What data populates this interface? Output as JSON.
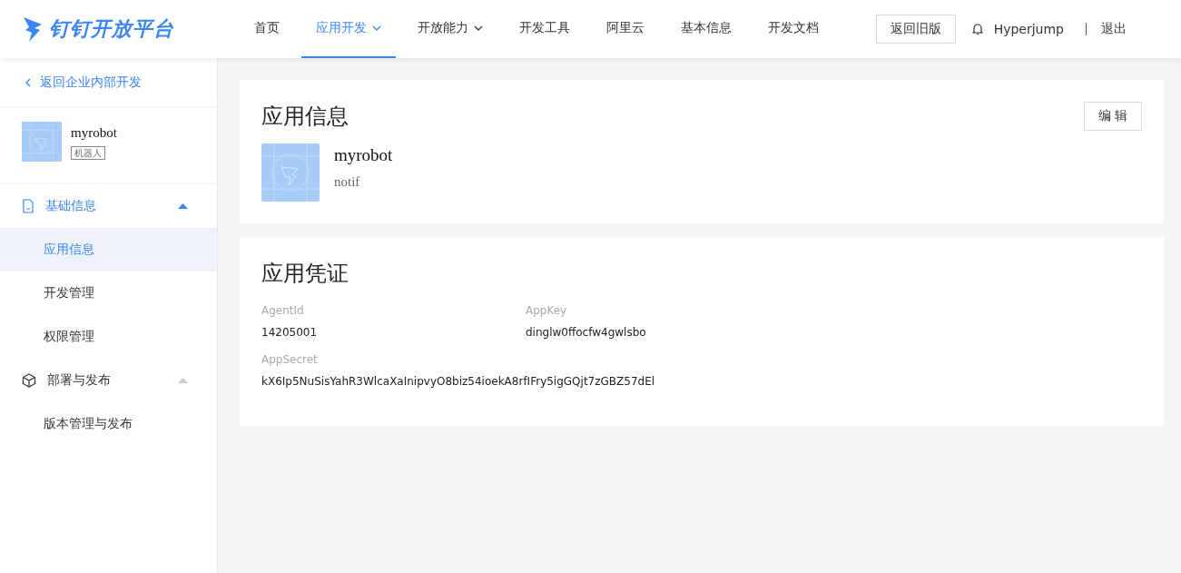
{
  "header": {
    "logo": "钉钉开放平台",
    "nav": [
      {
        "label": "首页",
        "selected": false,
        "dropdown": false
      },
      {
        "label": "应用开发",
        "selected": true,
        "dropdown": true
      },
      {
        "label": "开放能力",
        "selected": false,
        "dropdown": true
      },
      {
        "label": "开发工具",
        "selected": false,
        "dropdown": false
      },
      {
        "label": "阿里云",
        "selected": false,
        "dropdown": false
      },
      {
        "label": "基本信息",
        "selected": false,
        "dropdown": false
      },
      {
        "label": "开发文档",
        "selected": false,
        "dropdown": false
      }
    ],
    "old_version_button": "返回旧版",
    "user": "Hyperjump",
    "logout": "退出"
  },
  "sidebar": {
    "back_link": "返回企业内部开发",
    "app": {
      "name": "myrobot",
      "tag": "机器人"
    },
    "groups": [
      {
        "kind": "doc",
        "label": "基础信息",
        "selected": true,
        "expanded": true,
        "children": [
          {
            "label": "应用信息",
            "selected": true
          },
          {
            "label": "开发管理",
            "selected": false
          },
          {
            "label": "权限管理",
            "selected": false
          }
        ]
      },
      {
        "kind": "box",
        "label": "部署与发布",
        "selected": false,
        "expanded": true,
        "children": [
          {
            "label": "版本管理与发布",
            "selected": false
          }
        ]
      }
    ]
  },
  "app_info": {
    "title": "应用信息",
    "edit_button": "编 辑",
    "name": "myrobot",
    "description": "notif"
  },
  "credentials": {
    "title": "应用凭证",
    "fields": [
      {
        "label": "AgentId",
        "value": "14205001"
      },
      {
        "label": "AppKey",
        "value": "dinglw0ffocfw4gwlsbo"
      },
      {
        "label": "AppSecret",
        "value": "kX6Ip5NuSisYahR3WlcaXaInipvyO8biz54ioekA8rfIFry5igGQjt7zGBZ57dEl"
      }
    ]
  }
}
